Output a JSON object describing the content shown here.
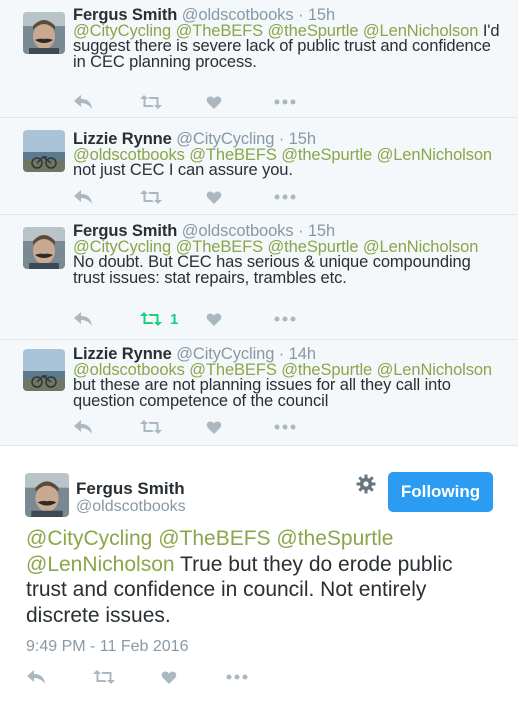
{
  "replies": [
    {
      "name": "Fergus Smith",
      "handle": "@oldscotbooks",
      "time": "· 15h",
      "mentions": [
        "@CityCycling",
        "@TheBEFS",
        "@theSpurtle",
        "@LenNicholson"
      ],
      "text": "I'd suggest there is severe lack of public trust and confidence in CEC planning process.",
      "retweet_count": ""
    },
    {
      "name": "Lizzie Rynne",
      "handle": "@CityCycling",
      "time": "· 15h",
      "mentions": [
        "@oldscotbooks",
        "@TheBEFS",
        "@theSpurtle",
        "@LenNicholson"
      ],
      "text": "not just CEC I can assure you.",
      "retweet_count": ""
    },
    {
      "name": "Fergus Smith",
      "handle": "@oldscotbooks",
      "time": "· 15h",
      "mentions": [
        "@CityCycling",
        "@TheBEFS",
        "@theSpurtle",
        "@LenNicholson"
      ],
      "text": "No doubt. But CEC has serious & unique compounding trust issues: stat repairs, trambles etc.",
      "retweet_count": "1"
    },
    {
      "name": "Lizzie Rynne",
      "handle": "@CityCycling",
      "time": "· 14h",
      "mentions": [
        "@oldscotbooks",
        "@TheBEFS",
        "@theSpurtle",
        "@LenNicholson"
      ],
      "text": "but these are not planning issues for all they call into question competence of the council",
      "retweet_count": ""
    }
  ],
  "main_tweet": {
    "name": "Fergus Smith",
    "handle": "@oldscotbooks",
    "follow_label": "Following",
    "mentions": [
      "@CityCycling",
      "@TheBEFS",
      "@theSpurtle",
      "@LenNicholson"
    ],
    "text": "True but they do erode public trust and confidence in council. Not entirely discrete issues.",
    "timestamp": "9:49 PM - 11 Feb 2016"
  },
  "icons": {
    "reply": "reply-arrow-icon",
    "retweet": "retweet-icon",
    "like": "heart-icon",
    "more": "more-dots-icon",
    "settings": "gear-icon"
  },
  "colors": {
    "mention": "#8ba54a",
    "handle": "#8899a6",
    "retweet_active": "#19cf86",
    "icon_gray": "#aab8c2",
    "follow_button": "#2b9cf2",
    "reply_background": "#f5f8fa"
  }
}
